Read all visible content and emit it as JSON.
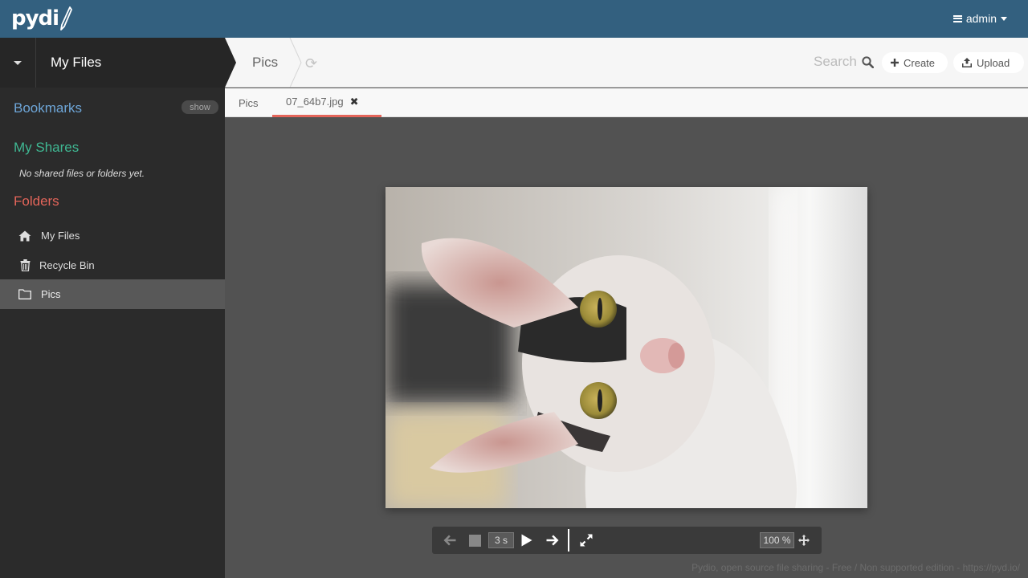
{
  "app": {
    "logo_text": "pydi"
  },
  "topbar": {
    "user_label": "admin"
  },
  "workspace": {
    "title": "My Files"
  },
  "breadcrumb": {
    "current": "Pics",
    "search_label": "Search"
  },
  "actions": {
    "create_label": "Create",
    "upload_label": "Upload"
  },
  "sidebar": {
    "bookmarks_title": "Bookmarks",
    "show_label": "show",
    "shares_title": "My Shares",
    "shares_empty": "No shared files or folders yet.",
    "folders_title": "Folders",
    "items": [
      {
        "label": "My Files",
        "icon": "home-icon"
      },
      {
        "label": "Recycle Bin",
        "icon": "trash-icon"
      },
      {
        "label": "Pics",
        "icon": "folder-icon",
        "selected": true
      }
    ]
  },
  "tabs": [
    {
      "label": "Pics"
    },
    {
      "label": "07_64b7.jpg",
      "active": true
    }
  ],
  "viewer": {
    "slideshow_delay": "3 s",
    "zoom": "100 %",
    "footer": "Pydio, open source file sharing - Free / Non supported edition - https://pyd.io/"
  },
  "colors": {
    "topbar": "#33607f",
    "bookmarks": "#6ea6d8",
    "shares": "#3fb893",
    "folders": "#e4655a",
    "tab_active": "#e4655a"
  }
}
